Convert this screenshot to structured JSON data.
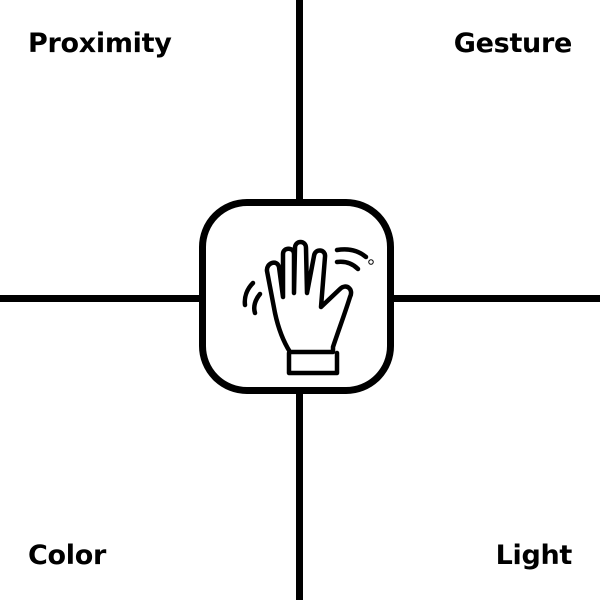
{
  "quadrants": {
    "top_left": "Proximity",
    "top_right": "Gesture",
    "bottom_left": "Color",
    "bottom_right": "Light"
  },
  "center_icon": "waving-hand-icon",
  "colors": {
    "stroke": "#000000",
    "background": "#ffffff"
  }
}
